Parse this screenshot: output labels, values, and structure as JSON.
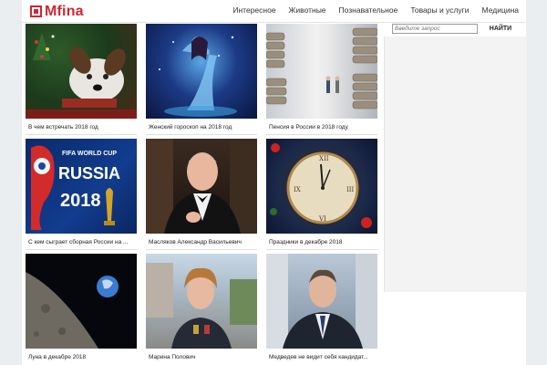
{
  "site": {
    "logo_text": "Mfina"
  },
  "nav": [
    {
      "label": "Интересное"
    },
    {
      "label": "Животные"
    },
    {
      "label": "Познавательное"
    },
    {
      "label": "Товары и услуги"
    },
    {
      "label": "Медицина"
    }
  ],
  "search": {
    "placeholder": "Введите запрос",
    "button_label": "НАЙТИ"
  },
  "cards": [
    {
      "caption": "В чем встречать 2018 год"
    },
    {
      "caption": "Женский гороскоп на 2018 год"
    },
    {
      "caption": "Пенсия в России в 2018 году"
    },
    {
      "caption": "С кем сыграет сборная России на ...",
      "image_text": [
        "FIFA WORLD CUP",
        "RUSSIA",
        "2018"
      ]
    },
    {
      "caption": "Масляков Александр Васильевич"
    },
    {
      "caption": "Праздники в декабре 2018"
    },
    {
      "caption": "Луна в декабре 2018"
    },
    {
      "caption": "Марина Полович"
    },
    {
      "caption": "Медведев не видит себя кандидат..."
    }
  ],
  "colors": {
    "brand": "#d0262f",
    "background": "#eaeef1"
  }
}
